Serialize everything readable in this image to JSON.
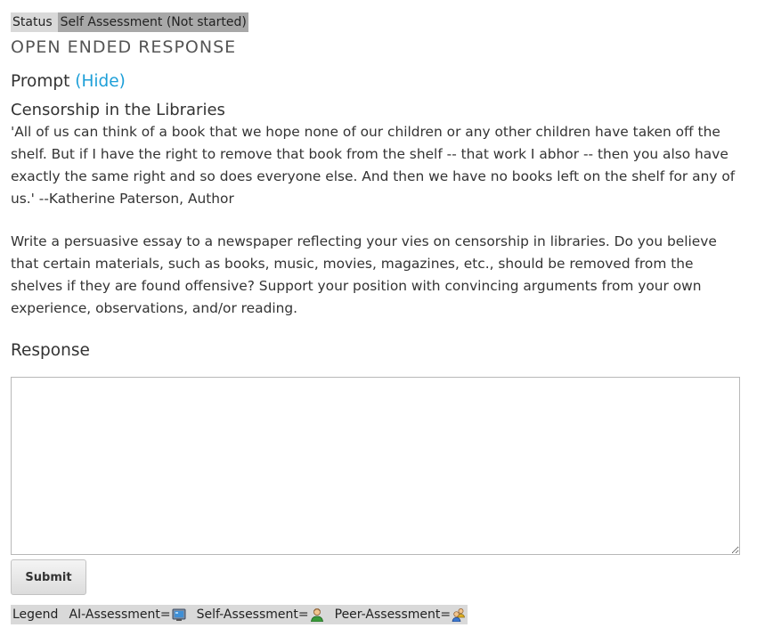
{
  "status": {
    "label": "Status",
    "value": "Self Assessment (Not started)"
  },
  "section_title": "OPEN ENDED RESPONSE",
  "prompt": {
    "heading": "Prompt",
    "toggle_label": "(Hide)",
    "title": "Censorship in the Libraries",
    "paragraph1": "'All of us can think of a book that we hope none of our children or any other children have taken off the shelf. But if I have the right to remove that book from the shelf -- that work I abhor -- then you also have exactly the same right and so does everyone else. And then we have no books left on the shelf for any of us.' --Katherine Paterson, Author",
    "paragraph2": "Write a persuasive essay to a newspaper reflecting your vies on censorship in libraries. Do you believe that certain materials, such as books, music, movies, magazines, etc., should be removed from the shelves if they are found offensive? Support your position with convincing arguments from your own experience, observations, and/or reading."
  },
  "response": {
    "heading": "Response",
    "value": ""
  },
  "submit_label": "Submit",
  "legend": {
    "label": "Legend",
    "items": [
      {
        "label": "AI-Assessment=",
        "icon": "computer-icon"
      },
      {
        "label": "Self-Assessment=",
        "icon": "person-icon"
      },
      {
        "label": "Peer-Assessment=",
        "icon": "people-icon"
      }
    ]
  },
  "colors": {
    "link": "#1d9fd8",
    "status_bg": "#d9d9d9",
    "status_value_bg": "#a8a8a8"
  }
}
